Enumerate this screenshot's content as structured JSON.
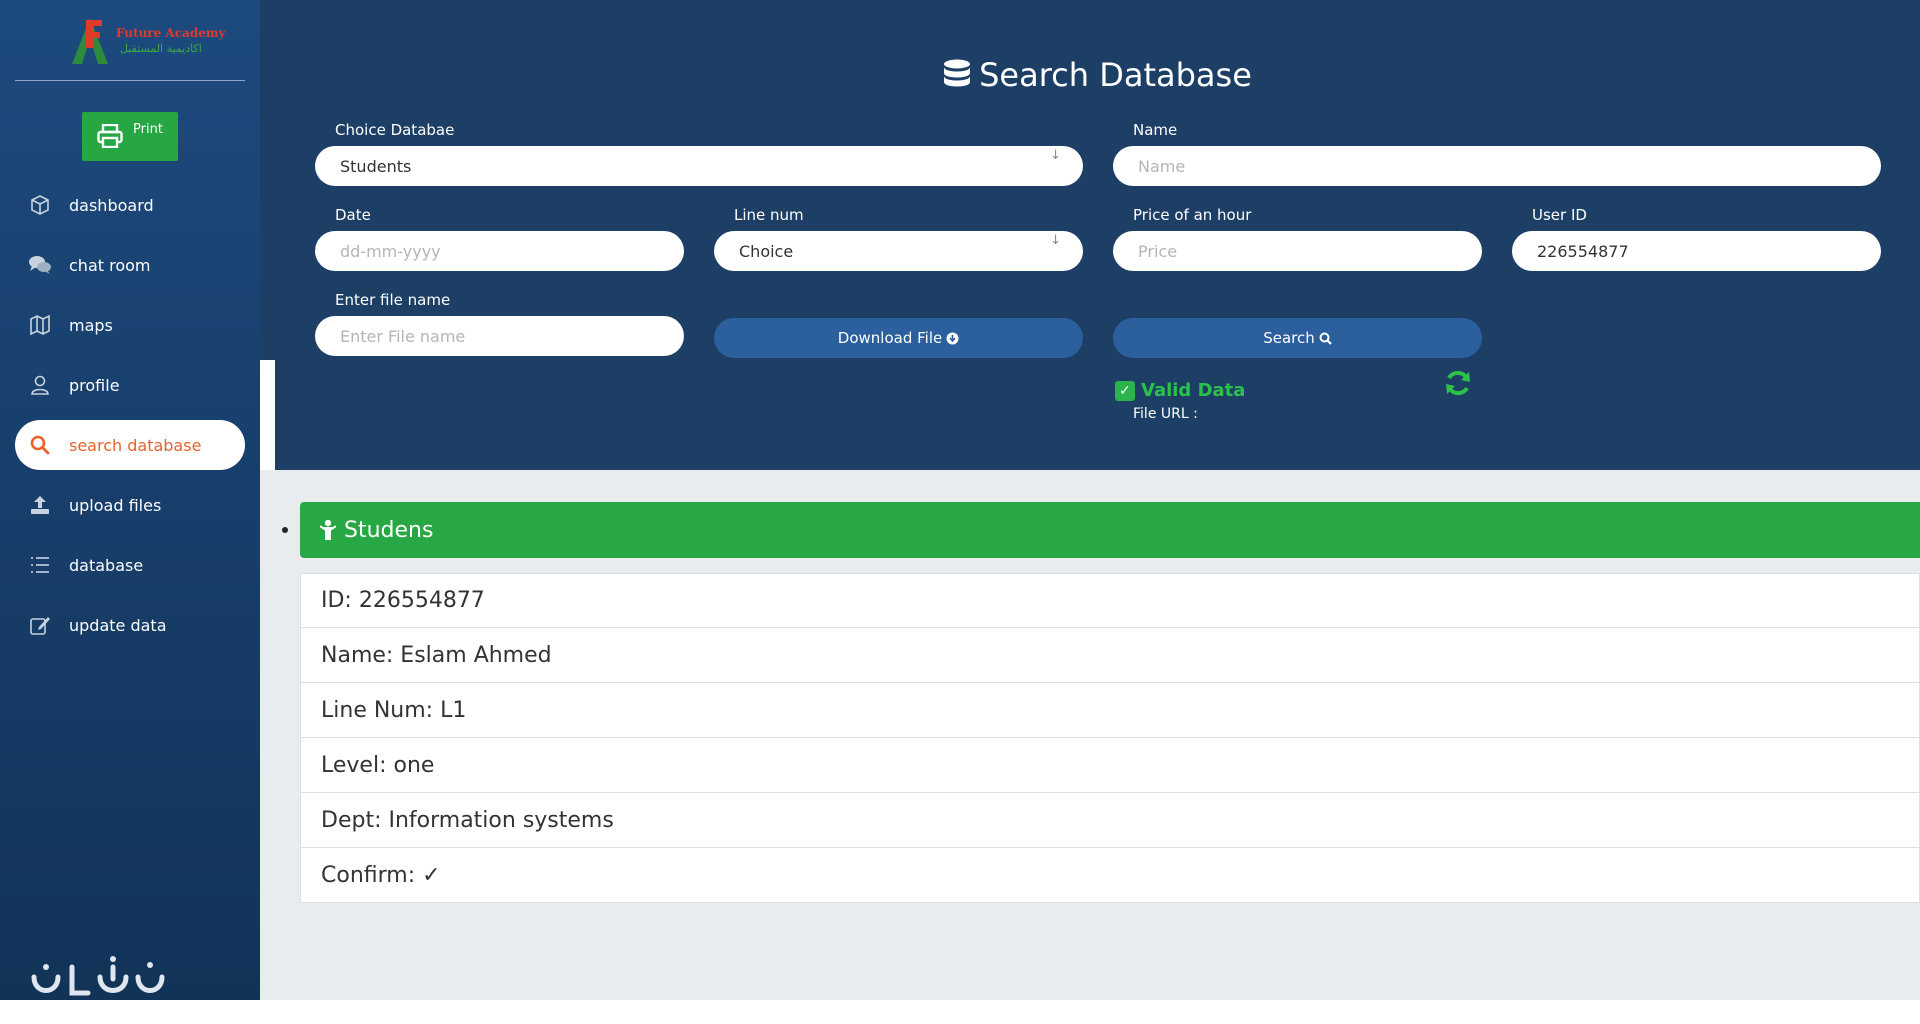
{
  "sidebar": {
    "logo": {
      "title_en": "Future Academy",
      "title_ar": "اكاديمية المستقبل"
    },
    "print_label": "Print",
    "items": [
      {
        "label": "dashboard",
        "icon": "cube-icon"
      },
      {
        "label": "chat room",
        "icon": "chat-icon"
      },
      {
        "label": "maps",
        "icon": "map-icon"
      },
      {
        "label": "profile",
        "icon": "user-icon"
      },
      {
        "label": "search database",
        "icon": "search-icon",
        "active": true
      },
      {
        "label": "upload files",
        "icon": "upload-icon"
      },
      {
        "label": "database",
        "icon": "list-icon"
      },
      {
        "label": "update data",
        "icon": "edit-icon"
      }
    ]
  },
  "search": {
    "title": "Search Database",
    "choice_label": "Choice Databae",
    "choice_value": "Students",
    "name_label": "Name",
    "name_placeholder": "Name",
    "date_label": "Date",
    "date_placeholder": "dd-mm-yyyy",
    "line_label": "Line num",
    "line_value": "Choice",
    "price_label": "Price of an hour",
    "price_placeholder": "Price",
    "userid_label": "User ID",
    "userid_value": "226554877",
    "file_label": "Enter file name",
    "file_placeholder": "Enter File name",
    "download_label": "Download File",
    "search_label": "Search",
    "valid_label": "Valid Data",
    "file_url_label": "File URL :"
  },
  "results": {
    "header": "Studens",
    "items": [
      "ID: 226554877",
      "Name: Eslam Ahmed",
      "Line Num: L1",
      "Level: one",
      "Dept: Information systems",
      "Confirm: ✓"
    ]
  },
  "colors": {
    "sidebar": "#1d4a7e",
    "panel": "#1d3f66",
    "accent_green": "#28a745",
    "accent_orange": "#e8622b",
    "button_blue": "#2b5f9e"
  }
}
